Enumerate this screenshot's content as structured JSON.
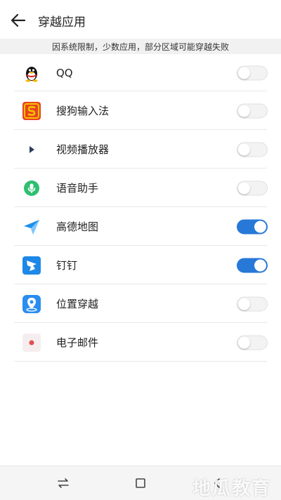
{
  "header": {
    "title": "穿越应用",
    "back_icon": "arrow-left-icon"
  },
  "notice": "因系统限制，少数应用，部分区域可能穿越失败",
  "apps": [
    {
      "name": "QQ",
      "icon": "qq-penguin-icon",
      "enabled": false
    },
    {
      "name": "搜狗输入法",
      "icon": "sogou-input-icon",
      "enabled": false
    },
    {
      "name": "视频播放器",
      "icon": "video-player-icon",
      "enabled": false
    },
    {
      "name": "语音助手",
      "icon": "voice-assistant-icon",
      "enabled": false
    },
    {
      "name": "高德地图",
      "icon": "amap-icon",
      "enabled": true
    },
    {
      "name": "钉钉",
      "icon": "dingtalk-icon",
      "enabled": true
    },
    {
      "name": "位置穿越",
      "icon": "location-pin-icon",
      "enabled": false
    },
    {
      "name": "电子邮件",
      "icon": "email-icon",
      "enabled": false
    }
  ],
  "navbar": {
    "icons": [
      "switch-arrows-icon",
      "home-square-icon",
      "back-arrow-icon"
    ]
  },
  "watermark": "地瓜教育",
  "colors": {
    "toggle_on": "#2878d8",
    "toggle_off": "#f3f3f3",
    "notice_bg": "#f1f1f1"
  }
}
